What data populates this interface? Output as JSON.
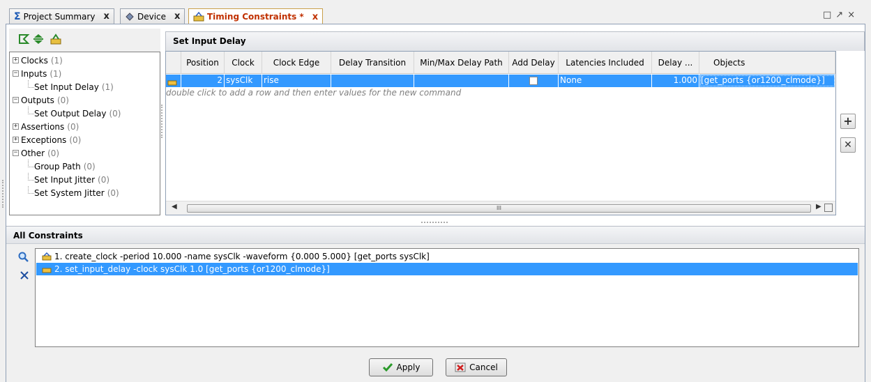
{
  "tabs": [
    {
      "label": "Project Summary",
      "close": "x"
    },
    {
      "label": "Device",
      "close": "x"
    },
    {
      "label": "Timing Constraints *",
      "close": "x"
    }
  ],
  "window_controls": {
    "restore": "□",
    "float": "↗",
    "close": "×"
  },
  "tree": {
    "clocks": {
      "label": "Clocks",
      "count": "(1)"
    },
    "inputs": {
      "label": "Inputs",
      "count": "(1)"
    },
    "set_input_delay": {
      "label": "Set Input Delay",
      "count": "(1)"
    },
    "outputs": {
      "label": "Outputs",
      "count": "(0)"
    },
    "set_output_delay": {
      "label": "Set Output Delay",
      "count": "(0)"
    },
    "assertions": {
      "label": "Assertions",
      "count": "(0)"
    },
    "exceptions": {
      "label": "Exceptions",
      "count": "(0)"
    },
    "other": {
      "label": "Other",
      "count": "(0)"
    },
    "group_path": {
      "label": "Group Path",
      "count": "(0)"
    },
    "set_input_jitter": {
      "label": "Set Input Jitter",
      "count": "(0)"
    },
    "set_system_jitter": {
      "label": "Set System Jitter",
      "count": "(0)"
    },
    "expand_plus": "+",
    "expand_minus": "−"
  },
  "set_input_delay": {
    "title": "Set Input Delay",
    "columns": [
      "Position",
      "Clock",
      "Clock Edge",
      "Delay Transition",
      "Min/Max Delay Path",
      "Add Delay",
      "Latencies Included",
      "Delay ...",
      "Objects"
    ],
    "row": {
      "position": "2",
      "clock": "sysClk",
      "clock_edge": "rise",
      "delay_transition": "",
      "minmax_path": "",
      "add_delay": "",
      "latencies": "None",
      "delay": "1.000",
      "objects": "[get_ports {or1200_clmode}]"
    },
    "hint": "double click to add a row and then enter values for the new command",
    "scroll_marker": "III",
    "add_btn": "+",
    "remove_btn": "✕"
  },
  "all_constraints": {
    "title": "All Constraints",
    "items": [
      "1. create_clock -period 10.000 -name sysClk -waveform {0.000 5.000} [get_ports sysClk]",
      "2. set_input_delay -clock sysClk 1.0 [get_ports {or1200_clmode}]"
    ]
  },
  "buttons": {
    "apply": "Apply",
    "cancel": "Cancel"
  },
  "colors": {
    "selection": "#3399ff",
    "accent_tab": "#c03000"
  }
}
